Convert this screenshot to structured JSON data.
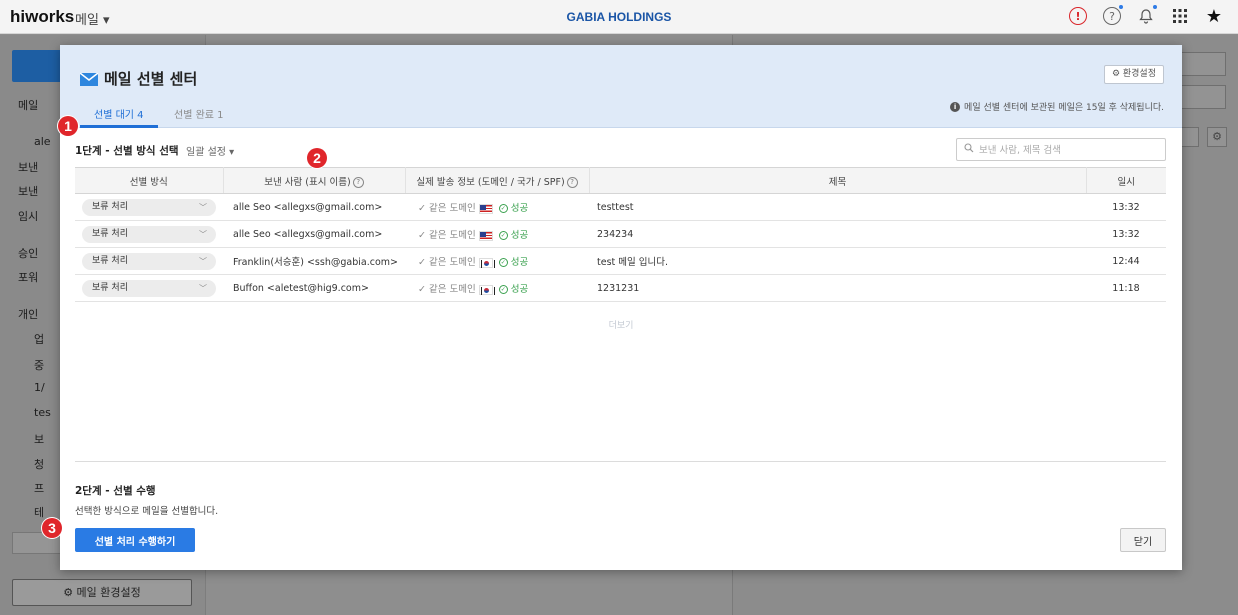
{
  "topbar": {
    "brand": "hiworks",
    "app_menu": "메일 ▾",
    "company": "GABIA HOLDINGS",
    "icons": [
      "alert-icon",
      "help-icon",
      "bell-icon",
      "apps-grid-icon",
      "star-icon"
    ],
    "alert_glyph": "!",
    "help_glyph": "?",
    "bell_glyph": "🔔",
    "grid_glyph": "⋮⋮⋮",
    "star_glyph": "★"
  },
  "sidebar": {
    "items": [
      "메일",
      "ale",
      "보낸",
      "보낸",
      "임시",
      "승인",
      "포워",
      "개인",
      "업",
      "중",
      "1/",
      "tes",
      "보",
      "청",
      "프",
      "테"
    ],
    "settings_label": "⚙ 메일 환경설정"
  },
  "modal": {
    "title": "메일 선별 센터",
    "env_button": "⚙ 환경설정",
    "tabs": [
      {
        "label": "선별 대기 4",
        "active": true
      },
      {
        "label": "선별 완료 1",
        "active": false
      }
    ],
    "notice": "메일 선별 센터에 보관된 메일은 15일 후 삭제됩니다.",
    "step1_title": "1단계 - 선별 방식 선택",
    "bulk_setting": "일괄 설정 ▾",
    "search_placeholder": "보낸 사람, 제목 검색",
    "columns": {
      "method": "선별 방식",
      "sender": "보낸 사람 (표시 이름)",
      "spf": "실제 발송 정보 (도메인 / 국가 / SPF)",
      "subject": "제목",
      "time": "일시"
    },
    "rows": [
      {
        "method": "보류 처리",
        "sender": "alle Seo <allegxs@gmail.com>",
        "domain": "✓ 같은 도메인",
        "country": "us",
        "spf": "성공",
        "subject": "testtest",
        "time": "13:32"
      },
      {
        "method": "보류 처리",
        "sender": "alle Seo <allegxs@gmail.com>",
        "domain": "✓ 같은 도메인",
        "country": "us",
        "spf": "성공",
        "subject": "234234",
        "time": "13:32"
      },
      {
        "method": "보류 처리",
        "sender": "Franklin(서승훈) <ssh@gabia.com>",
        "domain": "✓ 같은 도메인",
        "country": "kr",
        "spf": "성공",
        "subject": "test 메일 입니다.",
        "time": "12:44"
      },
      {
        "method": "보류 처리",
        "sender": "Buffon <aletest@hig9.com>",
        "domain": "✓ 같은 도메인",
        "country": "kr",
        "spf": "성공",
        "subject": "1231231",
        "time": "11:18"
      }
    ],
    "more": "더보기",
    "step2_title": "2단계 - 선별 수행",
    "step2_desc": "선택한 방식으로 메일을 선별합니다.",
    "run_button": "선별 처리 수행하기",
    "close_button": "닫기"
  },
  "badges": [
    "1",
    "2",
    "3"
  ],
  "colors": {
    "accent": "#2a7be4",
    "badge": "#e0262b",
    "header_bg": "#dfeaf8",
    "success": "#3aa14f",
    "company": "#1a55a6"
  }
}
